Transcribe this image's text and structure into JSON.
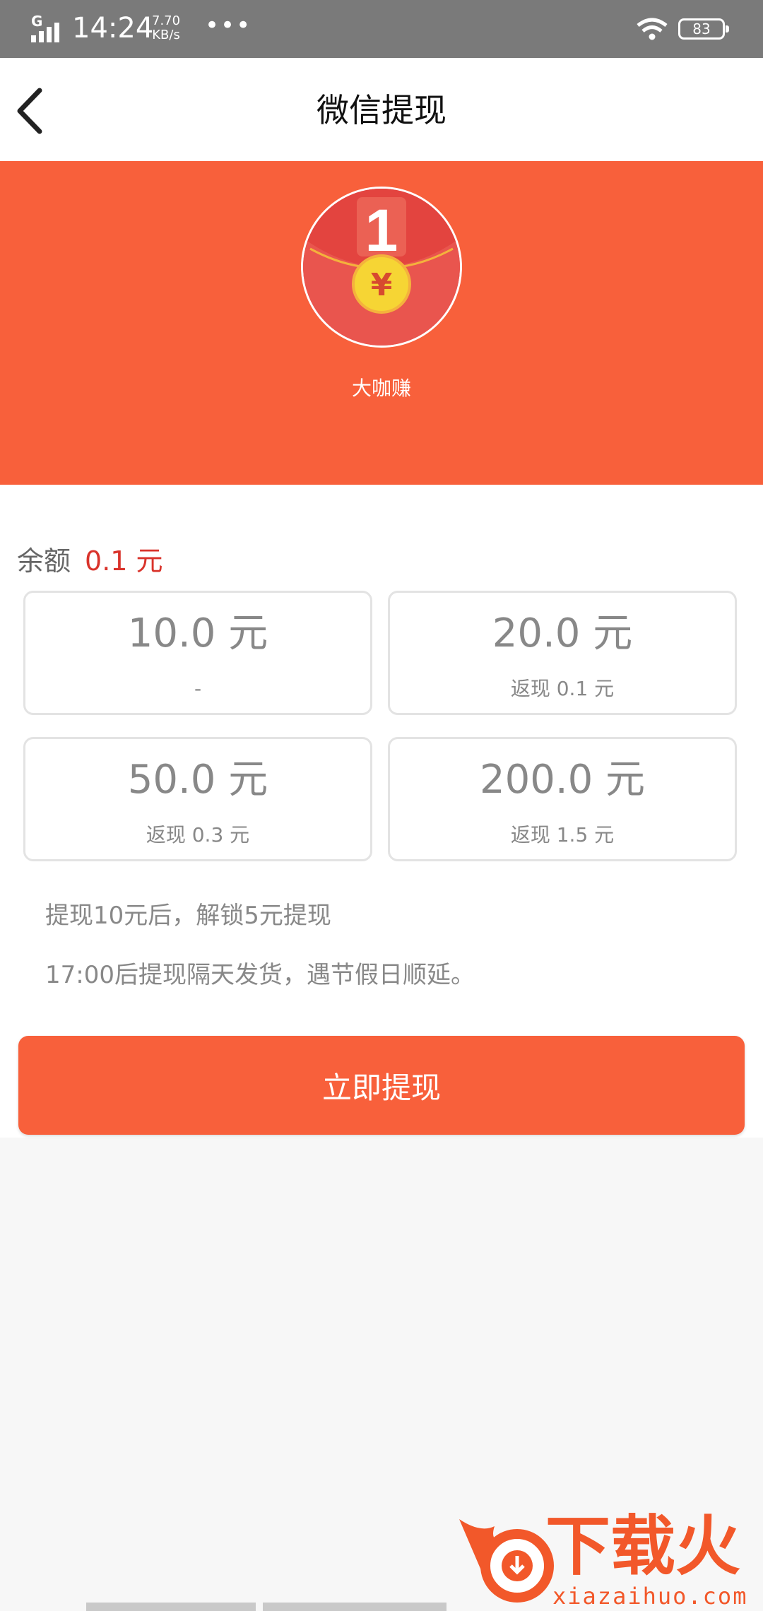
{
  "status_bar": {
    "network": "G",
    "time": "14:24",
    "speed_value": "7.70",
    "speed_unit": "KB/s",
    "more": "•••",
    "battery": "83"
  },
  "header": {
    "title": "微信提现"
  },
  "banner": {
    "app_name": "大咖赚",
    "logo_number": "1",
    "logo_symbol": "¥",
    "background_color": "#f8603b"
  },
  "balance": {
    "label": "余额",
    "value": "0.1 元"
  },
  "options": [
    {
      "amount": "10.0 元",
      "sub": "-"
    },
    {
      "amount": "20.0 元",
      "sub": "返现 0.1 元"
    },
    {
      "amount": "50.0 元",
      "sub": "返现 0.3 元"
    },
    {
      "amount": "200.0 元",
      "sub": "返现 1.5 元"
    }
  ],
  "notes": [
    "提现10元后，解锁5元提现",
    "17:00后提现隔天发货，遇节假日顺延。"
  ],
  "button": {
    "label": "立即提现"
  },
  "watermark": {
    "text": "下载火",
    "url": "xiazaihuo.com"
  }
}
